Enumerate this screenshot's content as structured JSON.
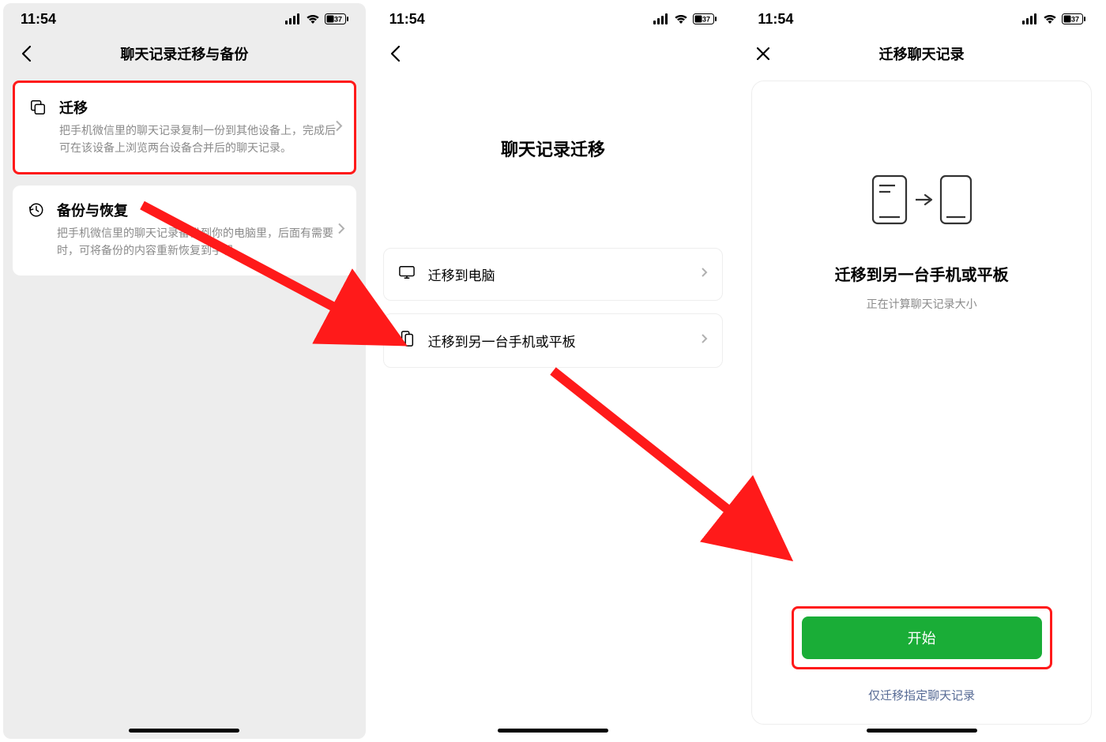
{
  "status": {
    "time": "11:54",
    "battery": "37"
  },
  "screen1": {
    "title": "聊天记录迁移与备份",
    "migrate": {
      "title": "迁移",
      "desc": "把手机微信里的聊天记录复制一份到其他设备上，完成后可在该设备上浏览两台设备合并后的聊天记录。"
    },
    "backup": {
      "title": "备份与恢复",
      "desc": "把手机微信里的聊天记录备份到你的电脑里，后面有需要时，可将备份的内容重新恢复到手机。"
    }
  },
  "screen2": {
    "title": "聊天记录迁移",
    "row_pc": "迁移到电脑",
    "row_phone": "迁移到另一台手机或平板"
  },
  "screen3": {
    "title": "迁移聊天记录",
    "heading": "迁移到另一台手机或平板",
    "sub": "正在计算聊天记录大小",
    "start": "开始",
    "link": "仅迁移指定聊天记录"
  }
}
